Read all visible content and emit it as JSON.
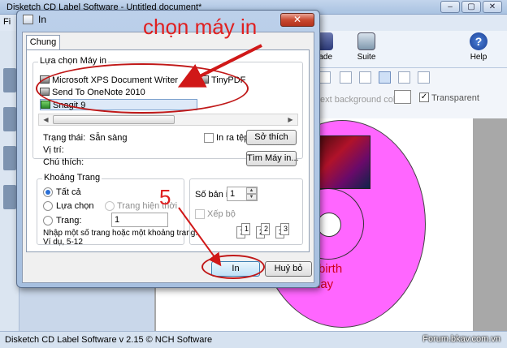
{
  "main_window": {
    "title": "Disketch CD Label Software - Untitled document*",
    "menu_partial": "Fi",
    "controls": {
      "minimize": "–",
      "maximize": "▢",
      "close": "✕"
    },
    "toolbar": {
      "upgrade_label": "rade",
      "suite_label": "Suite",
      "help_label": "Help"
    },
    "format": {
      "text_bg_label": "ext background color:",
      "transparent_label": "Transparent",
      "transparent_checked": true
    },
    "disc": {
      "text_line1": "py birth",
      "text_line2": "day"
    },
    "status_text": "Disketch CD Label Software v 2.15 © NCH Software",
    "watermark": "Forum.bkav.com.vn"
  },
  "dialog": {
    "title": "In",
    "close": "✕",
    "tab": "Chung",
    "printers_label": "Lựa chọn Máy in",
    "printers": [
      {
        "name": "Microsoft XPS Document Writer",
        "selected": false
      },
      {
        "name": "TinyPDF",
        "selected": false
      },
      {
        "name": "Send To OneNote 2010",
        "selected": false
      },
      {
        "name": "Snagit 9",
        "selected": true
      }
    ],
    "status_label": "Trạng thái:",
    "status_value": "Sẵn sàng",
    "location_label": "Vị trí:",
    "comment_label": "Chú thích:",
    "print_to_file_label": "In ra tệp",
    "print_to_file_checked": false,
    "preferences_button": "Sở thích",
    "find_printer_button": "Tìm Máy in...",
    "page_range": {
      "group_label": "Khoảng Trang",
      "all_label": "Tất cả",
      "selection_label": "Lựa chọn",
      "current_page_label": "Trang hiện thời",
      "pages_label": "Trang:",
      "pages_value": "1",
      "selected": "all",
      "hint_line1": "Nhập một số trang hoặc một khoảng trang.",
      "hint_line2": "Ví dụ, 5-12"
    },
    "copies": {
      "label": "Số bản in:",
      "value": "1",
      "collate_label": "Xếp bộ",
      "collate_checked": false
    },
    "print_button": "In",
    "cancel_button": "Huỷ bỏ"
  },
  "annotations": {
    "title": "chọn máy in",
    "step": "5",
    "color": "#e02020"
  }
}
